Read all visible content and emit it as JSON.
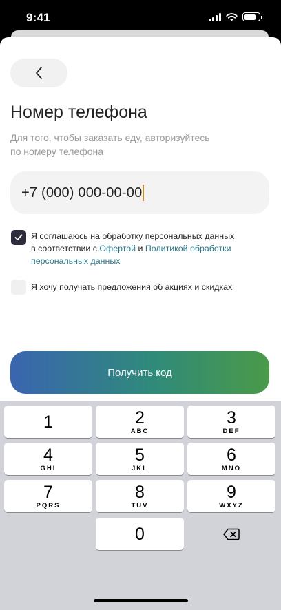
{
  "status": {
    "time": "9:41",
    "battery_level": 0.8
  },
  "form": {
    "title": "Номер телефона",
    "subtitle": "Для того, чтобы заказать еду, авторизуйтесь по номеру телефона",
    "phone_value": "+7 (000) 000-00-00",
    "consent": {
      "checked": true,
      "text_before": "Я соглашаюсь на обработку персональных данных в соответствии с ",
      "offer_link": "Офертой",
      "and": " и ",
      "policy_link": "Политикой обработки персональных данных"
    },
    "promo": {
      "checked": false,
      "text": "Я хочу получать предложения об акциях и скидках"
    },
    "submit_label": "Получить код"
  },
  "keyboard": {
    "keys": [
      {
        "digit": "1",
        "letters": ""
      },
      {
        "digit": "2",
        "letters": "ABC"
      },
      {
        "digit": "3",
        "letters": "DEF"
      },
      {
        "digit": "4",
        "letters": "GHI"
      },
      {
        "digit": "5",
        "letters": "JKL"
      },
      {
        "digit": "6",
        "letters": "MNO"
      },
      {
        "digit": "7",
        "letters": "PQRS"
      },
      {
        "digit": "8",
        "letters": "TUV"
      },
      {
        "digit": "9",
        "letters": "WXYZ"
      }
    ],
    "zero": "0"
  },
  "icons": {
    "back": "chevron-left-icon",
    "check": "checkmark-icon",
    "delete": "backspace-icon",
    "signal": "cellular-signal-icon",
    "wifi": "wifi-icon",
    "battery": "battery-icon"
  }
}
